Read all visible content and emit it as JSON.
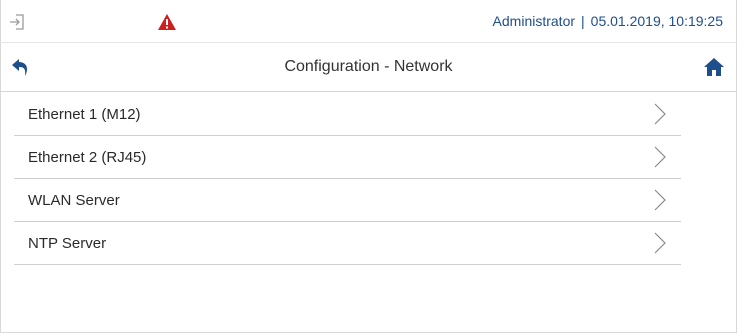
{
  "status_bar": {
    "user": "Administrator",
    "separator": "|",
    "datetime": "05.01.2019, 10:19:25",
    "login_icon": "login-icon",
    "warning_icon": "warning-icon"
  },
  "title_bar": {
    "title": "Configuration - Network",
    "back_icon": "back-arrow-icon",
    "home_icon": "home-icon"
  },
  "menu": {
    "items": [
      {
        "label": "Ethernet 1 (M12)"
      },
      {
        "label": "Ethernet 2 (RJ45)"
      },
      {
        "label": "WLAN Server"
      },
      {
        "label": "NTP Server"
      }
    ]
  },
  "colors": {
    "accent_blue": "#1f4e8c",
    "warning_red": "#cc1f1f"
  }
}
